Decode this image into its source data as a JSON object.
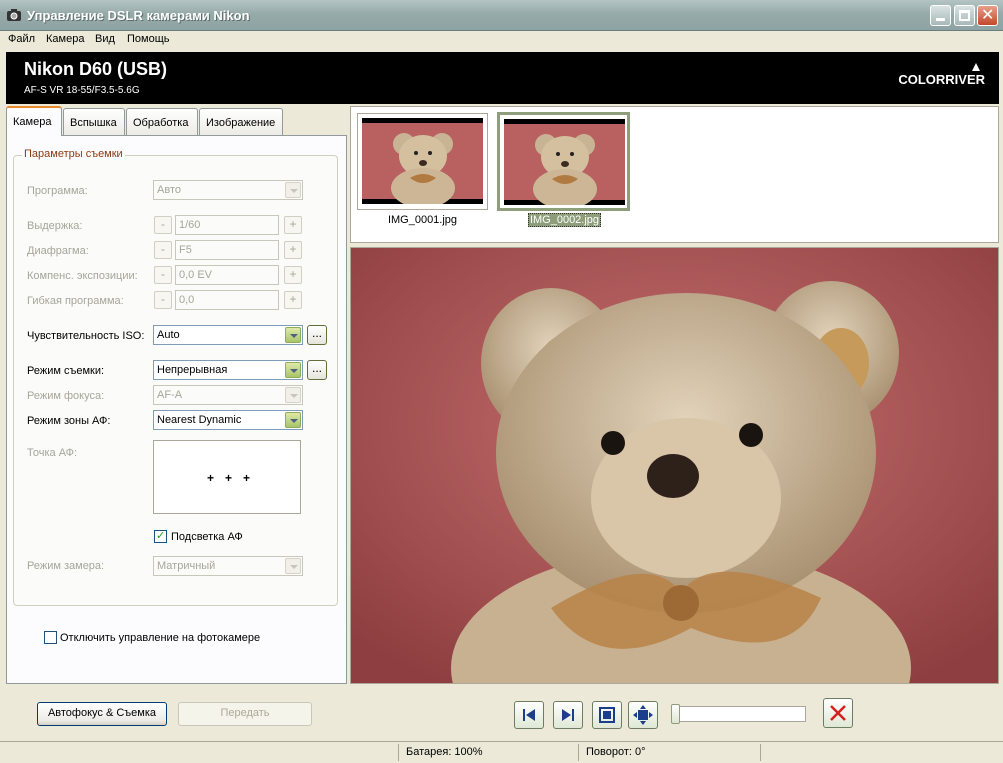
{
  "window": {
    "title": "Управление DSLR камерами Nikon"
  },
  "menu": [
    "Файл",
    "Камера",
    "Вид",
    "Помощь"
  ],
  "header": {
    "camera": "Nikon D60 (USB)",
    "lens": "AF-S VR 18-55/F3.5-5.6G",
    "logo": "COLORRIVER"
  },
  "tabs": [
    "Камера",
    "Вспышка",
    "Обработка",
    "Изображение"
  ],
  "group_title": "Параметры съемки",
  "fields": {
    "program": {
      "label": "Программа:",
      "value": "Авто"
    },
    "shutter": {
      "label": "Выдержка:",
      "value": "1/60"
    },
    "aperture": {
      "label": "Диафрагма:",
      "value": "F5"
    },
    "exposure_comp": {
      "label": "Компенс. экспозиции:",
      "value": "0,0 EV"
    },
    "flex_program": {
      "label": "Гибкая программа:",
      "value": "0,0"
    },
    "iso": {
      "label": "Чувствительность ISO:",
      "value": "Auto"
    },
    "shooting_mode": {
      "label": "Режим съемки:",
      "value": "Непрерывная"
    },
    "focus_mode": {
      "label": "Режим фокуса:",
      "value": "AF-A"
    },
    "af_area_mode": {
      "label": "Режим зоны АФ:",
      "value": "Nearest Dynamic"
    },
    "af_point": {
      "label": "Точка АФ:"
    },
    "af_assist": {
      "label": "Подсветка АФ",
      "checked": true
    },
    "metering": {
      "label": "Режим замера:",
      "value": "Матричный"
    },
    "disable_control": {
      "label": "Отключить управление на фотокамере",
      "checked": false
    }
  },
  "minus": "-",
  "plus": "+",
  "ellipsis": "...",
  "af_dot": "+",
  "thumbnails": [
    {
      "label": "IMG_0001.jpg",
      "selected": false
    },
    {
      "label": "IMG_0002.jpg",
      "selected": true
    }
  ],
  "buttons": {
    "autofocus_shoot": "Автофокус & Съемка",
    "transfer": "Передать"
  },
  "status": {
    "battery": "Батарея: 100%",
    "rotation": "Поворот: 0°"
  },
  "colors": {
    "accent": "#8e9e7a",
    "header_bg": "#000000",
    "photo_bg": "#b55b5b"
  }
}
